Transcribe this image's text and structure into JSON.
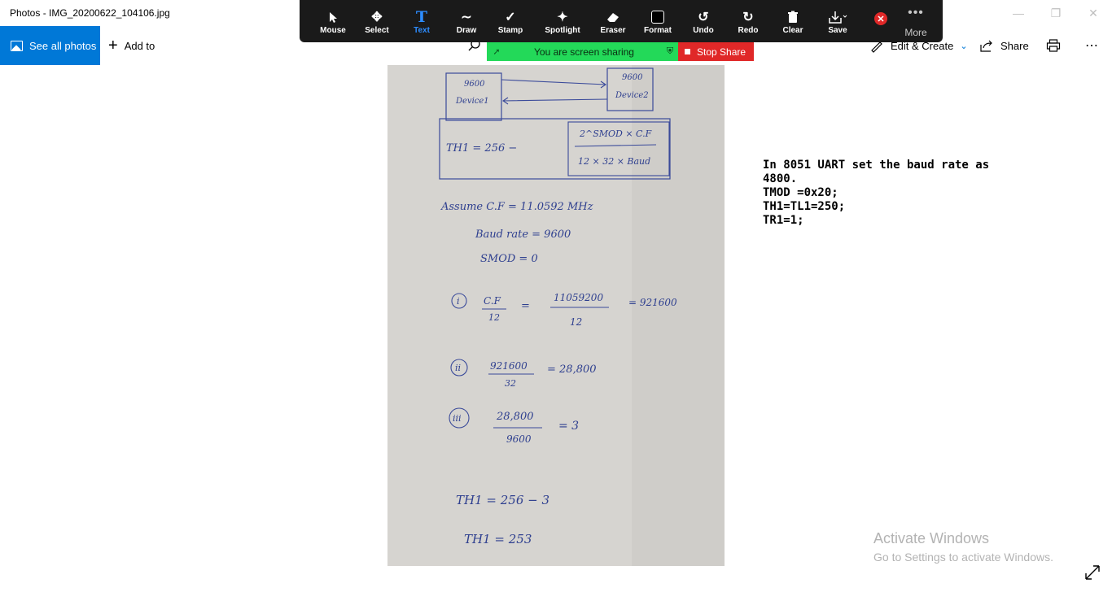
{
  "window": {
    "title": "Photos - IMG_20200622_104106.jpg"
  },
  "toolbar": {
    "see_all_label": "See all photos",
    "add_to_label": "Add to",
    "edit_create_label": "Edit & Create",
    "share_label": "Share"
  },
  "annotate": {
    "items": [
      {
        "label": "Mouse",
        "icon": "mouse-pointer-icon"
      },
      {
        "label": "Select",
        "icon": "move-icon"
      },
      {
        "label": "Text",
        "icon": "text-icon"
      },
      {
        "label": "Draw",
        "icon": "draw-icon"
      },
      {
        "label": "Stamp",
        "icon": "check-icon"
      },
      {
        "label": "Spotlight",
        "icon": "magic-wand-icon"
      },
      {
        "label": "Eraser",
        "icon": "eraser-icon"
      },
      {
        "label": "Format",
        "icon": "format-icon"
      },
      {
        "label": "Undo",
        "icon": "undo-icon"
      },
      {
        "label": "Redo",
        "icon": "redo-icon"
      },
      {
        "label": "Clear",
        "icon": "trash-icon"
      },
      {
        "label": "Save",
        "icon": "save-icon"
      }
    ],
    "active": "Text",
    "more_label": "More"
  },
  "sharing": {
    "status": "You are screen sharing",
    "stop_label": "Stop Share"
  },
  "photo": {
    "device1_baud": "9600",
    "device1_label": "Device1",
    "device2_baud": "9600",
    "device2_label": "Device2",
    "formula_lhs": "TH1 = 256 −",
    "formula_num": "2^SMOD × C.F",
    "formula_den": "12 × 32 × Baud",
    "assume_line": "Assume C.F = 11.0592 MHz",
    "baud_line": "Baud rate = 9600",
    "smod_line": "SMOD = 0",
    "step1_marker": "i",
    "step1_num": "C.F",
    "step1_den": "12",
    "step1_mid_num": "11059200",
    "step1_mid_den": "12",
    "step1_result": "= 921600",
    "step2_marker": "ii",
    "step2_num": "921600",
    "step2_den": "32",
    "step2_result": "= 28,800",
    "step3_marker": "iii",
    "step3_num": "28,800",
    "step3_den": "9600",
    "step3_result": "= 3",
    "th_line1": "TH1 = 256 − 3",
    "th_line2": "TH1 = 253"
  },
  "note": {
    "line1": "In 8051 UART set the baud rate as",
    "line2": "4800.",
    "line3": "TMOD =0x20;",
    "line4": "TH1=TL1=250;",
    "line5": "TR1=1;"
  },
  "watermark": {
    "title": "Activate Windows",
    "subtitle": "Go to Settings to activate Windows."
  }
}
